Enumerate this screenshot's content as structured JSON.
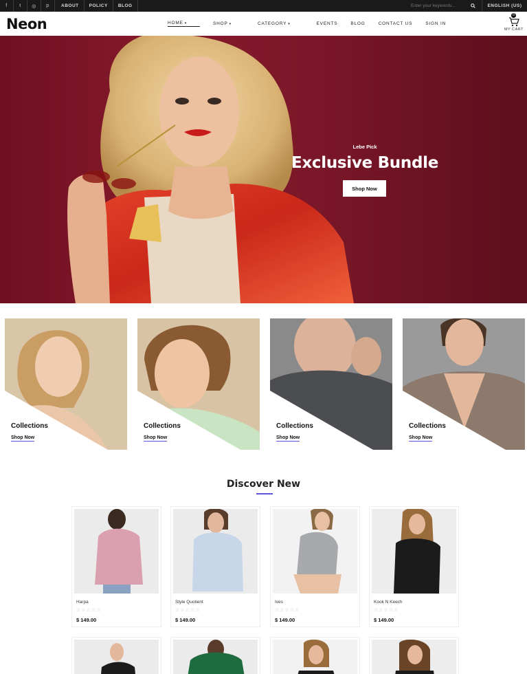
{
  "topbar": {
    "social": [
      {
        "icon": "facebook-icon",
        "glyph": "f"
      },
      {
        "icon": "twitter-icon",
        "glyph": "t"
      },
      {
        "icon": "instagram-icon",
        "glyph": "◎"
      },
      {
        "icon": "pinterest-icon",
        "glyph": "p"
      }
    ],
    "links": [
      "ABOUT",
      "POLICY",
      "BLOG"
    ],
    "search_placeholder": "Enter your keywords...",
    "language": "ENGLISH (US)"
  },
  "header": {
    "logo": "Neon",
    "nav": [
      {
        "label": "HOME",
        "has_caret": true,
        "active": true
      },
      {
        "label": "SHOP",
        "has_caret": true,
        "active": false
      },
      {
        "label": "CATEGORY",
        "has_caret": true,
        "active": false
      },
      {
        "label": "EVENTS",
        "has_caret": false,
        "active": false
      },
      {
        "label": "BLOG",
        "has_caret": false,
        "active": false
      },
      {
        "label": "CONTACT US",
        "has_caret": false,
        "active": false
      },
      {
        "label": "SIGN IN",
        "has_caret": false,
        "active": false
      }
    ],
    "cart_count": "0",
    "cart_label": "MY CART"
  },
  "hero": {
    "kicker": "Lebe Pick",
    "title": "Exclusive Bundle",
    "button": "Shop Now",
    "background_color": "#7a1728"
  },
  "collections": [
    {
      "title": "Collections",
      "link": "Shop Now"
    },
    {
      "title": "Collections",
      "link": "Shop Now"
    },
    {
      "title": "Collections",
      "link": "Shop Now"
    },
    {
      "title": "Collections",
      "link": "Shop Now"
    }
  ],
  "discover": {
    "title": "Discover New",
    "accent_color": "#5a55d8",
    "products": [
      {
        "name": "Harpa",
        "price": "$ 149.00",
        "rating": 0
      },
      {
        "name": "Style Quotient",
        "price": "$ 149.00",
        "rating": 0
      },
      {
        "name": "Ives",
        "price": "$ 149.00",
        "rating": 0
      },
      {
        "name": "Kook N Keech",
        "price": "$ 149.00",
        "rating": 0
      }
    ]
  }
}
